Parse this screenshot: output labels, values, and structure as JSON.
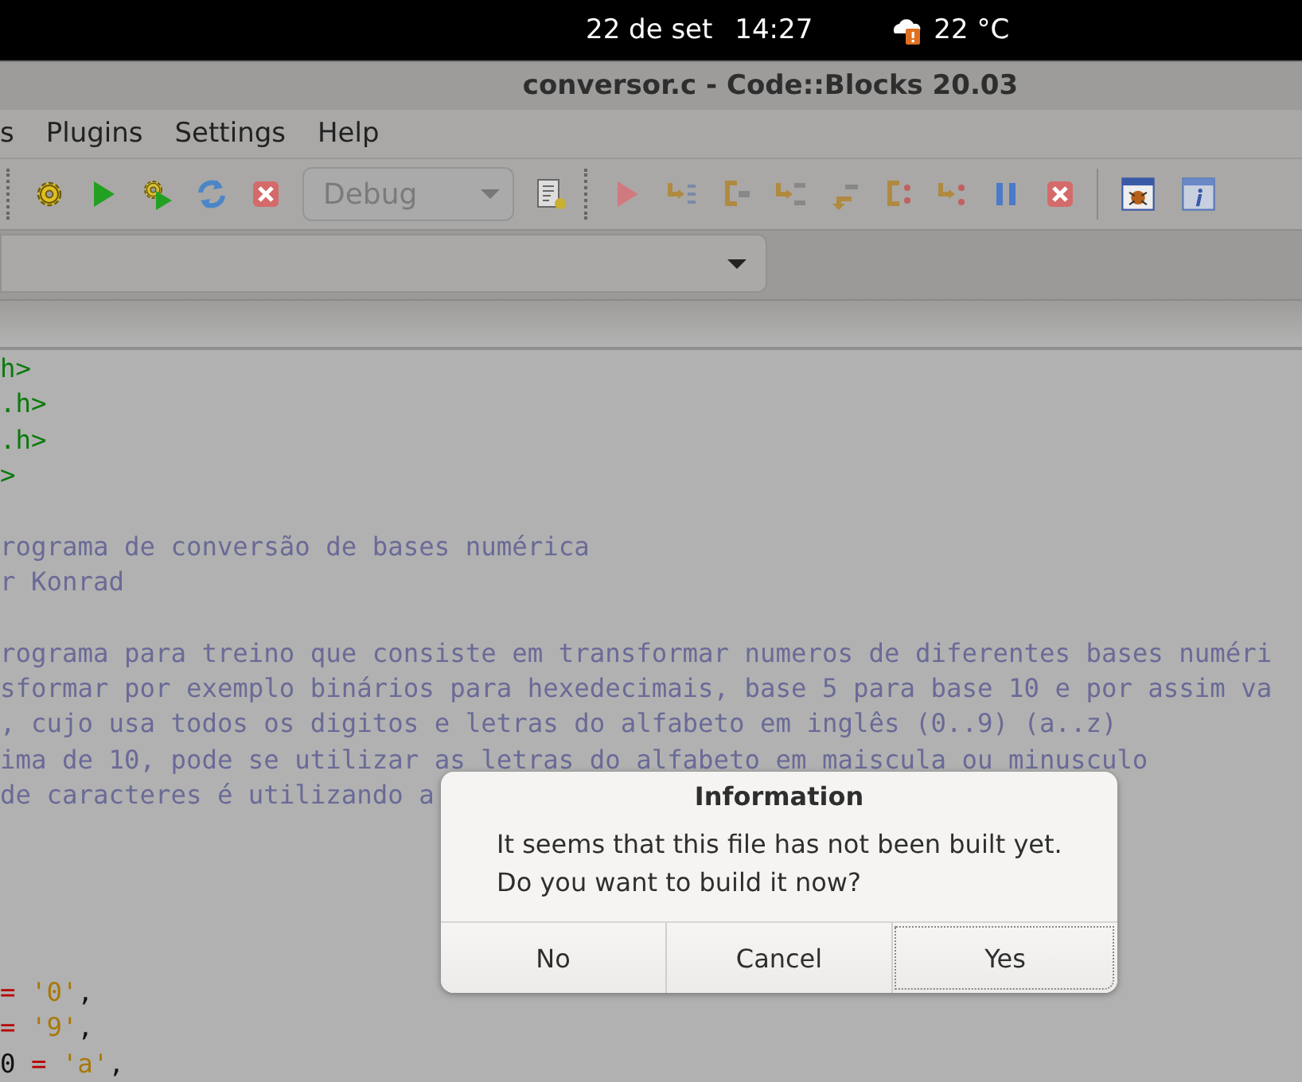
{
  "top_bar": {
    "date": "22 de set",
    "time": "14:27",
    "temperature": "22 °C"
  },
  "window": {
    "title": "conversor.c - Code::Blocks 20.03"
  },
  "menu": [
    "s",
    "Plugins",
    "Settings",
    "Help"
  ],
  "toolbar": {
    "build_target": {
      "value": "Debug",
      "disabled": true
    }
  },
  "editor": {
    "blocks": [
      {
        "lines": [
          [
            {
              "kind": "include",
              "text": "h>"
            }
          ],
          [
            {
              "kind": "include",
              "text": ".h>"
            }
          ],
          [
            {
              "kind": "include",
              "text": ".h>"
            }
          ],
          [
            {
              "kind": "include",
              "text": ">"
            }
          ]
        ]
      },
      {
        "lines": [
          [
            {
              "kind": "comment",
              "text": "rograma de conversão de bases numérica"
            }
          ],
          [
            {
              "kind": "comment",
              "text": "r Konrad"
            }
          ]
        ]
      },
      {
        "lines": [
          [
            {
              "kind": "comment",
              "text": "rograma para treino que consiste em transformar numeros de diferentes bases numéri"
            }
          ],
          [
            {
              "kind": "comment",
              "text": "sformar por exemplo binários para hexedecimais, base 5 para base 10 e por assim va"
            }
          ],
          [
            {
              "kind": "comment",
              "text": ", cujo usa todos os digitos e letras do alfabeto em inglês (0..9) (a..z)"
            }
          ],
          [
            {
              "kind": "comment",
              "text": "ima de 10, pode se utilizar as letras do alfabeto em maiscula ou minusculo"
            }
          ],
          [
            {
              "kind": "comment",
              "text": "de caracteres é utilizando a"
            }
          ]
        ]
      }
    ],
    "bottom_lines": [
      [
        {
          "kind": "operator",
          "text": "="
        },
        {
          "kind": "string",
          "text": "'0'"
        },
        {
          "kind": "plain",
          "text": ","
        }
      ],
      [
        {
          "kind": "operator",
          "text": "="
        },
        {
          "kind": "string",
          "text": "'9'"
        },
        {
          "kind": "plain",
          "text": ","
        }
      ],
      [
        {
          "kind": "plain",
          "text": "0"
        },
        {
          "kind": "operator",
          "text": "="
        },
        {
          "kind": "string",
          "text": "'a'"
        },
        {
          "kind": "plain",
          "text": ","
        }
      ]
    ]
  },
  "dialog": {
    "title": "Information",
    "message": [
      "It seems that this file has not been built yet.",
      "Do you want to build it now?"
    ],
    "buttons": [
      {
        "label": "No",
        "focused": false
      },
      {
        "label": "Cancel",
        "focused": false
      },
      {
        "label": "Yes",
        "focused": true
      }
    ]
  }
}
